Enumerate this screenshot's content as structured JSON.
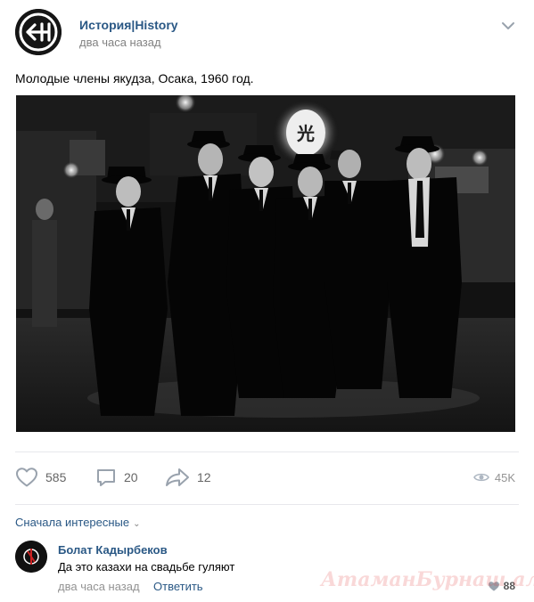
{
  "post": {
    "author": "История|History",
    "time": "два часа назад",
    "text": "Молодые члены якудза, Осака, 1960 год.",
    "avatar_icon": "history-logo-icon",
    "menu_icon": "chevron-down-icon"
  },
  "actions": {
    "likes": "585",
    "comments": "20",
    "shares": "12",
    "views": "45K"
  },
  "comments_section": {
    "sort_label": "Сначала интересные",
    "items": [
      {
        "author": "Болат Кадырбеков",
        "text": "Да это казахи на свадьбе гуляют",
        "time": "два часа назад",
        "reply_label": "Ответить",
        "likes": "88"
      }
    ]
  },
  "watermark": "АтаманБурнаш ал● ЯП",
  "colors": {
    "link": "#2a5885",
    "meta": "#828282",
    "icon": "#99a2ad",
    "divider": "#e7e8ec"
  }
}
